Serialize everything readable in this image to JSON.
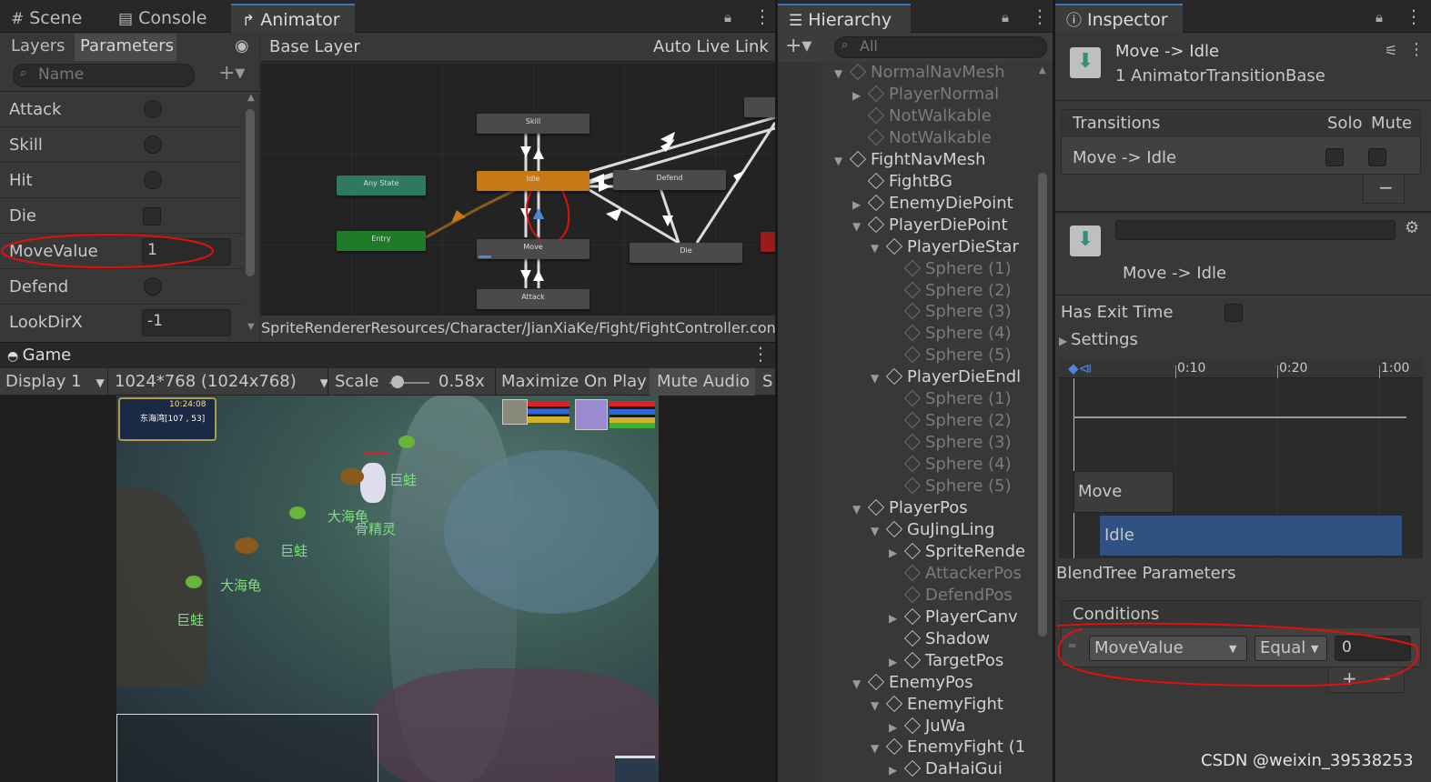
{
  "animator_window": {
    "tabs": [
      {
        "label": "Scene",
        "icon": "hash-icon"
      },
      {
        "label": "Console",
        "icon": "console-icon"
      },
      {
        "label": "Animator",
        "icon": "animator-icon"
      }
    ],
    "subtabs": {
      "layers": "Layers",
      "parameters": "Parameters"
    },
    "breadcrumb": "Base Layer",
    "auto_live_link": "Auto Live Link",
    "search_placeholder": "Name",
    "parameters": [
      {
        "name": "Attack",
        "type": "trigger"
      },
      {
        "name": "Skill",
        "type": "trigger"
      },
      {
        "name": "Hit",
        "type": "trigger"
      },
      {
        "name": "Die",
        "type": "bool"
      },
      {
        "name": "MoveValue",
        "type": "float",
        "value": "1"
      },
      {
        "name": "Defend",
        "type": "trigger"
      },
      {
        "name": "LookDirX",
        "type": "float",
        "value": "-1"
      }
    ],
    "states": {
      "skill": "Skill",
      "idle": "Idle",
      "move": "Move",
      "attack": "Attack",
      "defend": "Defend",
      "die": "Die",
      "any_state": "Any State",
      "entry": "Entry"
    },
    "path": "SpriteRendererResources/Character/JianXiaKe/Fight/FightController.controller"
  },
  "game_window": {
    "tab": "Game",
    "display": "Display 1",
    "resolution": "1024*768 (1024x768)",
    "scale_label": "Scale",
    "scale_value": "0.58x",
    "scale_fraction": 0.05,
    "maximize": "Maximize On Play",
    "mute": "Mute Audio",
    "stats_cut": "S",
    "hud_time": "10:24:08",
    "hud_map": "东海湾[107 , 53]",
    "labels": [
      "巨蛙",
      "大海龟",
      "骨精灵",
      "巨蛙",
      "大海龟",
      "巨蛙"
    ]
  },
  "hierarchy": {
    "tab": "Hierarchy",
    "search_placeholder": "All",
    "rows": [
      {
        "label": "NormalNavMesh",
        "dim": true,
        "expand": "down"
      },
      {
        "label": "PlayerNormal",
        "dim": true,
        "expand": "right"
      },
      {
        "label": "NotWalkable",
        "dim": true,
        "expand": ""
      },
      {
        "label": "NotWalkable",
        "dim": true,
        "expand": ""
      },
      {
        "label": "FightNavMesh",
        "dim": false,
        "expand": "down"
      },
      {
        "label": "FightBG",
        "dim": false,
        "expand": ""
      },
      {
        "label": "EnemyDiePoint",
        "dim": false,
        "expand": "right"
      },
      {
        "label": "PlayerDiePoint",
        "dim": false,
        "expand": "down"
      },
      {
        "label": "PlayerDieStar",
        "dim": false,
        "expand": "down"
      },
      {
        "label": "Sphere (1)",
        "dim": true,
        "expand": ""
      },
      {
        "label": "Sphere (2)",
        "dim": true,
        "expand": ""
      },
      {
        "label": "Sphere (3)",
        "dim": true,
        "expand": ""
      },
      {
        "label": "Sphere (4)",
        "dim": true,
        "expand": ""
      },
      {
        "label": "Sphere (5)",
        "dim": true,
        "expand": ""
      },
      {
        "label": "PlayerDieEndl",
        "dim": false,
        "expand": "down"
      },
      {
        "label": "Sphere (1)",
        "dim": true,
        "expand": ""
      },
      {
        "label": "Sphere (2)",
        "dim": true,
        "expand": ""
      },
      {
        "label": "Sphere (3)",
        "dim": true,
        "expand": ""
      },
      {
        "label": "Sphere (4)",
        "dim": true,
        "expand": ""
      },
      {
        "label": "Sphere (5)",
        "dim": true,
        "expand": ""
      },
      {
        "label": "PlayerPos",
        "dim": false,
        "expand": "down"
      },
      {
        "label": "GuJingLing",
        "dim": false,
        "expand": "down"
      },
      {
        "label": "SpriteRende",
        "dim": false,
        "expand": "right"
      },
      {
        "label": "AttackerPos",
        "dim": true,
        "expand": ""
      },
      {
        "label": "DefendPos",
        "dim": true,
        "expand": ""
      },
      {
        "label": "PlayerCanv",
        "dim": false,
        "expand": "right"
      },
      {
        "label": "Shadow",
        "dim": false,
        "expand": ""
      },
      {
        "label": "TargetPos",
        "dim": false,
        "expand": "right"
      },
      {
        "label": "EnemyPos",
        "dim": false,
        "expand": "down"
      },
      {
        "label": "EnemyFight",
        "dim": false,
        "expand": "down"
      },
      {
        "label": "JuWa",
        "dim": false,
        "expand": "right"
      },
      {
        "label": "EnemyFight (1",
        "dim": false,
        "expand": "down"
      },
      {
        "label": "DaHaiGui",
        "dim": false,
        "expand": "right"
      }
    ]
  },
  "inspector": {
    "tab": "Inspector",
    "title": "Move -> Idle",
    "subtitle": "1 AnimatorTransitionBase",
    "transitions_header": "Transitions",
    "solo": "Solo",
    "mute": "Mute",
    "transition_row": "Move -> Idle",
    "name_field": "",
    "transition_name": "Move -> Idle",
    "has_exit_time": "Has Exit Time",
    "settings": "Settings",
    "timeline_ticks": [
      "0:10",
      "0:20",
      "1:00"
    ],
    "timeline_move": "Move",
    "timeline_idle": "Idle",
    "blendtree": "BlendTree Parameters",
    "conditions": "Conditions",
    "cond_param": "MoveValue",
    "cond_op": "Equal",
    "cond_value": "0",
    "watermark": "CSDN @weixin_39538253"
  },
  "colors": {
    "accent": "#3a79bb",
    "idle_state": "#c77918",
    "any_state": "#2f7a5f",
    "entry_state": "#1f7a29",
    "annotation": "#e01010"
  }
}
